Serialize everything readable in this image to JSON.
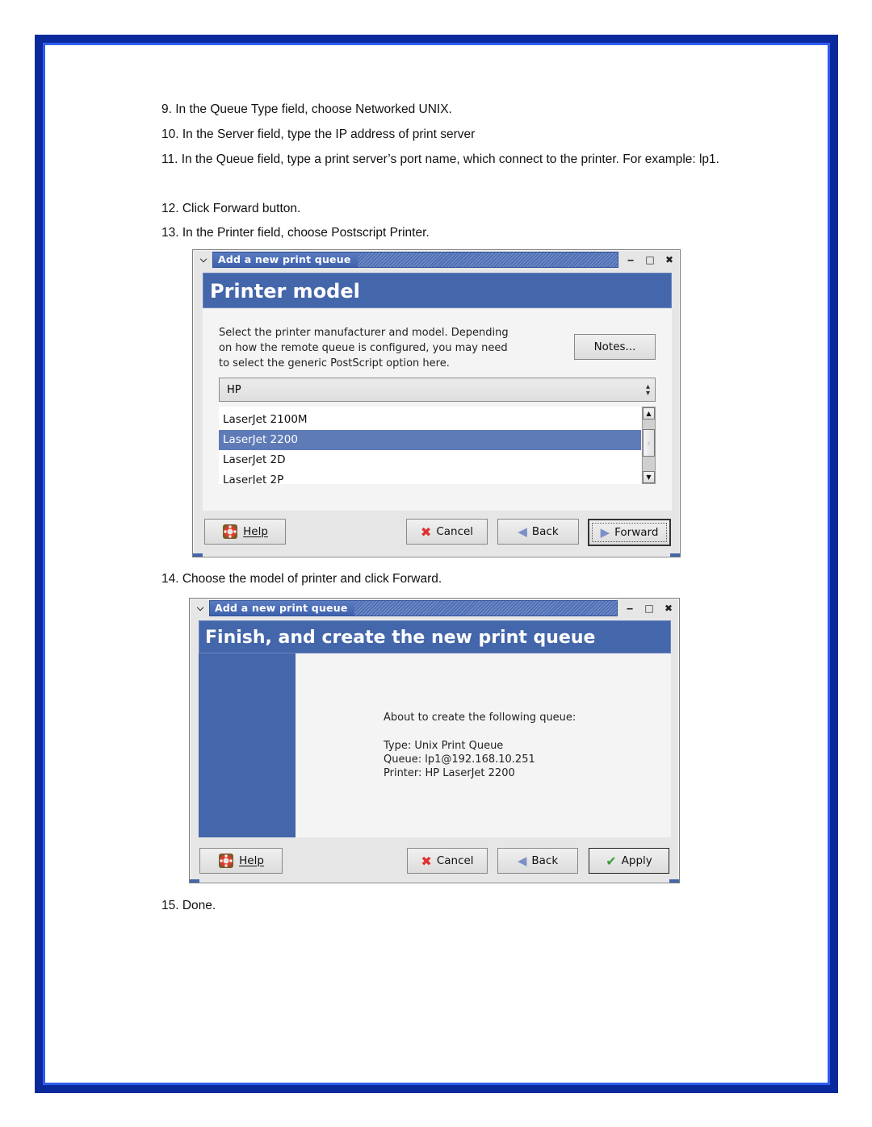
{
  "steps": {
    "s9": "9. In the Queue Type field, choose Networked UNIX.",
    "s10": "10. In the Server field, type the IP address of print server",
    "s11": "11. In the Queue field, type a print server’s port name, which connect to the printer. For example: lp1.",
    "s12": "12. Click Forward button.",
    "s13": "13. In the Printer field, choose Postscript Printer.",
    "s14": "14. Choose the model of printer and click Forward.",
    "s15": "15. Done."
  },
  "dialog1": {
    "window_title": "Add a new print queue",
    "heading": "Printer model",
    "description": "Select the printer manufacturer and model. Depending on how the remote queue is configured, you may need to select the generic PostScript option here.",
    "description_lines": [
      "Select the printer manufacturer and model. Depending",
      "on how the remote queue is configured, you may need",
      "to select the generic PostScript option here."
    ],
    "notes_button": "Notes...",
    "manufacturer_selected": "HP",
    "models": [
      {
        "label": "LaserJet 2100M",
        "selected": false
      },
      {
        "label": "LaserJet 2200",
        "selected": true
      },
      {
        "label": "LaserJet 2D",
        "selected": false
      },
      {
        "label": "LaserJet 2P",
        "selected": false
      }
    ],
    "buttons": {
      "help": "Help",
      "cancel": "Cancel",
      "back": "Back",
      "forward": "Forward"
    }
  },
  "dialog2": {
    "window_title": "Add a new print queue",
    "heading": "Finish, and create the new print queue",
    "intro": "About to create the following queue:",
    "type_line": "Type: Unix Print Queue",
    "queue_line": "Queue: lp1@192.168.10.251",
    "printer_line": "Printer: HP LaserJet 2200",
    "buttons": {
      "help": "Help",
      "cancel": "Cancel",
      "back": "Back",
      "apply": "Apply"
    }
  },
  "colors": {
    "frame_dark": "#0a2a9c",
    "frame_light": "#2f5cf0",
    "banner": "#4466aa",
    "selection": "#5e7bb8"
  }
}
